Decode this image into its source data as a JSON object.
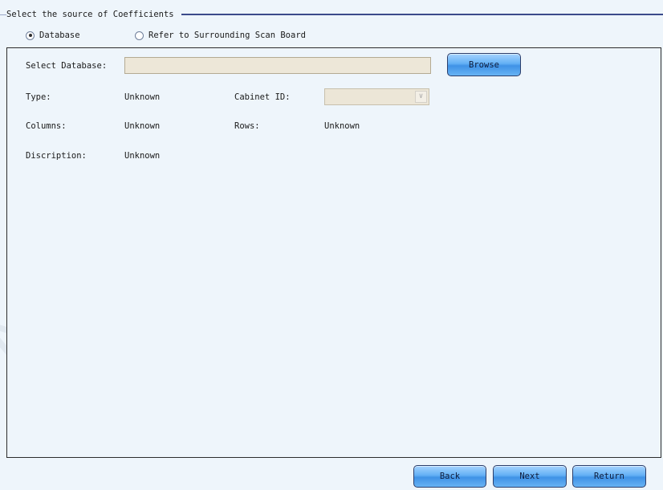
{
  "group": {
    "title": "Select the source of Coefficients"
  },
  "source_options": [
    {
      "label": "Database",
      "checked": true
    },
    {
      "label": "Refer to Surrounding Scan Board",
      "checked": false
    }
  ],
  "database": {
    "label": "Select Database:",
    "value": "",
    "browse_label": "Browse"
  },
  "info": {
    "type_label": "Type:",
    "type_value": "Unknown",
    "cabinet_label": "Cabinet ID:",
    "cabinet_value": "",
    "columns_label": "Columns:",
    "columns_value": "Unknown",
    "rows_label": "Rows:",
    "rows_value": "Unknown",
    "description_label": "Discription:",
    "description_value": "Unknown"
  },
  "footer": {
    "back_label": "Back",
    "next_label": "Next",
    "return_label": "Return"
  },
  "watermark": "NOVASTAR",
  "colors": {
    "background": "#eef5fb",
    "button_blue": "#4f9ff0",
    "input_beige": "#ede7d8",
    "group_line": "#3b4a8a"
  }
}
